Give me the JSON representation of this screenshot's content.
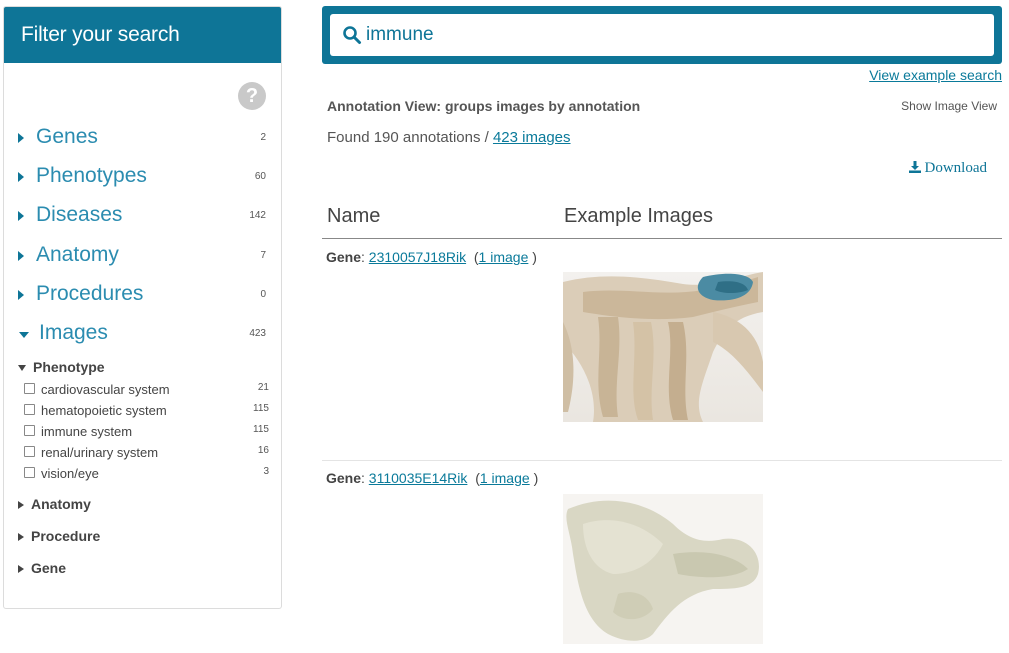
{
  "sidebar": {
    "header": "Filter your search",
    "help_icon": "question-circle-icon",
    "facets": [
      {
        "label": "Genes",
        "count": "2",
        "expanded": false
      },
      {
        "label": "Phenotypes",
        "count": "60",
        "expanded": false
      },
      {
        "label": "Diseases",
        "count": "142",
        "expanded": false
      },
      {
        "label": "Anatomy",
        "count": "7",
        "expanded": false
      },
      {
        "label": "Procedures",
        "count": "0",
        "expanded": false
      },
      {
        "label": "Images",
        "count": "423",
        "expanded": true
      }
    ],
    "images_sub": {
      "phenotype_label": "Phenotype",
      "options": [
        {
          "label": "cardiovascular system",
          "count": "21",
          "checked": false
        },
        {
          "label": "hematopoietic system",
          "count": "115",
          "checked": false
        },
        {
          "label": "immune system",
          "count": "115",
          "checked": false
        },
        {
          "label": "renal/urinary system",
          "count": "16",
          "checked": false
        },
        {
          "label": "vision/eye",
          "count": "3",
          "checked": false
        }
      ],
      "collapsed_groups": [
        "Anatomy",
        "Procedure",
        "Gene"
      ]
    }
  },
  "search": {
    "value": "immune",
    "icon": "search-icon"
  },
  "main": {
    "example_link": "View example search",
    "view_title": "Annotation View: groups images by annotation",
    "show_image_view": "Show Image View",
    "found_prefix": "Found 190 annotations / ",
    "found_images_link": "423 images",
    "download_label": "Download",
    "columns": [
      "Name",
      "Example Images"
    ],
    "rows": [
      {
        "prefix": "Gene",
        "gene": "2310057J18Rik",
        "images_link": "1 image",
        "open_paren": "(",
        "close_paren": ")"
      },
      {
        "prefix": "Gene",
        "gene": "3110035E14Rik",
        "images_link": "1 image",
        "open_paren": "(",
        "close_paren": ")"
      }
    ]
  },
  "colors": {
    "brand": "#0e7597",
    "link": "#0a7a9a",
    "facet_text": "#2b8cb0"
  }
}
